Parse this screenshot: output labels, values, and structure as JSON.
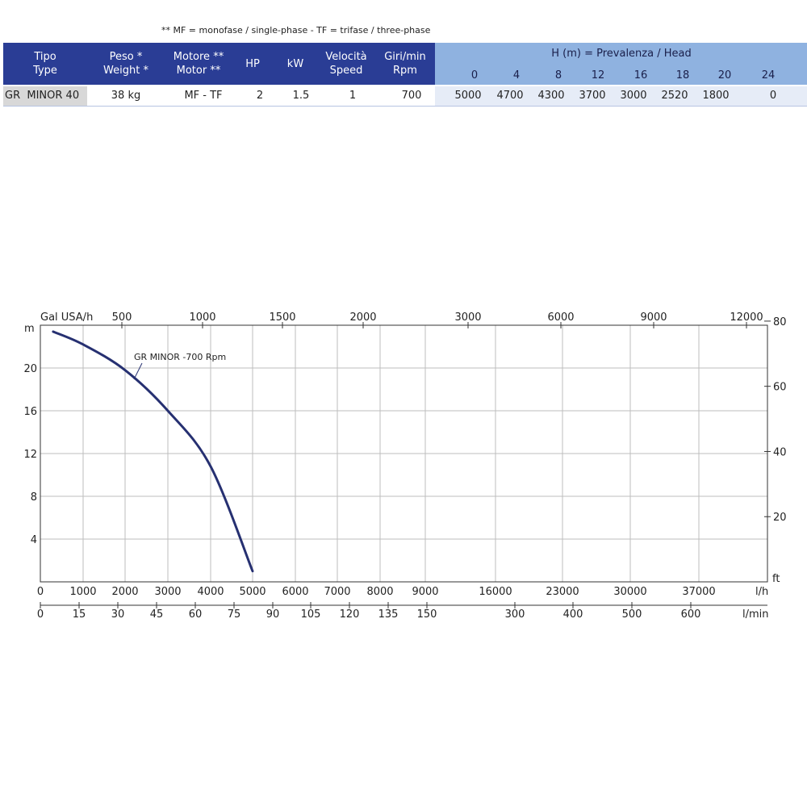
{
  "note": "** MF = monofase / single-phase - TF = trifase / three-phase",
  "table": {
    "headers": {
      "tipo": [
        "Tipo",
        "Type"
      ],
      "peso": [
        "Peso *",
        "Weight *"
      ],
      "motore": [
        "Motore **",
        "Motor **"
      ],
      "hp": "HP",
      "kw": "kW",
      "velocita": [
        "Velocità",
        "Speed"
      ],
      "giri": [
        "Giri/min",
        "Rpm"
      ],
      "head_title": "H (m) = Prevalenza / Head",
      "head_values": [
        "0",
        "4",
        "8",
        "12",
        "16",
        "18",
        "20",
        "24"
      ]
    },
    "row": {
      "name": "GR  MINOR 40",
      "weight": "38 kg",
      "motor": "MF - TF",
      "hp": "2",
      "kw": "1.5",
      "speed": "1",
      "rpm": "700",
      "flows": [
        "5000",
        "4700",
        "4300",
        "3700",
        "3000",
        "2520",
        "1800",
        "0"
      ]
    }
  },
  "chart_data": {
    "type": "line",
    "series": [
      {
        "name": "GR MINOR -700 Rpm",
        "points": [
          [
            300,
            23.4
          ],
          [
            1000,
            22.2
          ],
          [
            2000,
            19.8
          ],
          [
            3000,
            16.0
          ],
          [
            4000,
            10.8
          ],
          [
            5000,
            1.0
          ]
        ]
      }
    ],
    "y_left": {
      "label": "m",
      "ylim": [
        0,
        24
      ],
      "ticks": [
        4,
        8,
        12,
        16,
        20
      ]
    },
    "y_right": {
      "label": "ft",
      "ticks": [
        20,
        40,
        60,
        80
      ]
    },
    "x_bottom_lh": {
      "label": "l/h",
      "ticks": [
        0,
        1000,
        2000,
        3000,
        4000,
        5000,
        6000,
        7000,
        8000,
        9000,
        16000,
        23000,
        30000,
        37000
      ]
    },
    "x_bottom_lmin": {
      "label": "l/min",
      "ticks": [
        "0",
        "15",
        "30",
        "45",
        "60",
        "75",
        "90",
        "105",
        "120",
        "135",
        "150",
        "300",
        "400",
        "500",
        "600"
      ]
    },
    "x_top_galusa": {
      "label": "Gal USA/h",
      "ticks": [
        "500",
        "1000",
        "1500",
        "2000",
        "3000",
        "6000",
        "9000",
        "12000"
      ]
    },
    "grid": true,
    "colors": {
      "curve": "#263071",
      "grid": "#bdbdbd",
      "header_dark": "#2a3d95",
      "header_light": "#8fb2e0"
    }
  }
}
